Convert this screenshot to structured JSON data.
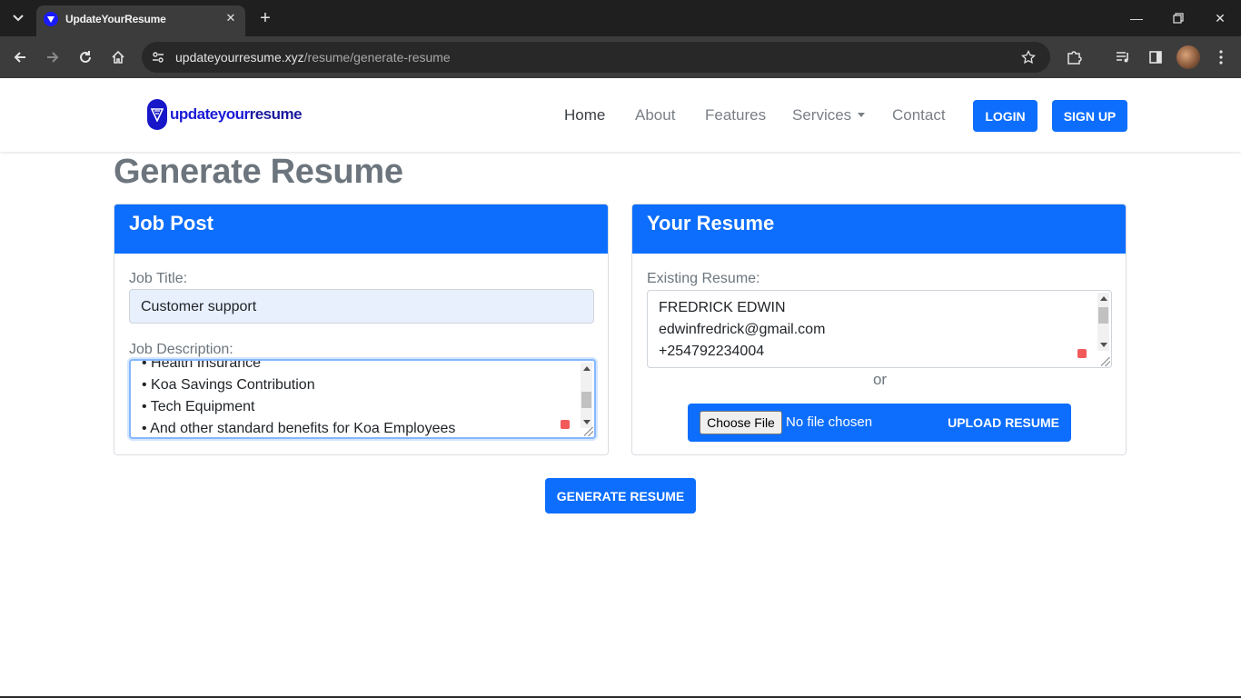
{
  "browser": {
    "tab_title": "UpdateYourResume",
    "url_domain": "updateyourresume.xyz",
    "url_path": "/resume/generate-resume"
  },
  "nav": {
    "brand_part1": "update",
    "brand_part2": "your",
    "brand_part3": "resume",
    "links": [
      "Home",
      "About",
      "Features",
      "Services",
      "Contact"
    ],
    "login_label": "LOGIN",
    "signup_label": "SIGN UP"
  },
  "page_title": "Generate Resume",
  "job_post": {
    "header": "Job Post",
    "title_label": "Job Title:",
    "title_value": "Customer support",
    "description_label": "Job Description:",
    "description_lines": [
      "• Health Insurance",
      "• Koa Savings Contribution",
      "• Tech Equipment",
      "• And other standard benefits for Koa Employees"
    ]
  },
  "your_resume": {
    "header": "Your Resume",
    "existing_label": "Existing Resume:",
    "resume_lines": [
      "FREDRICK EDWIN",
      "edwinfredrick@gmail.com",
      "+254792234004"
    ],
    "or_text": "or",
    "choose_file_label": "Choose File",
    "no_file_text": "No file chosen",
    "upload_label": "UPLOAD RESUME"
  },
  "generate_label": "GENERATE RESUME",
  "colors": {
    "primary": "#0d6efd",
    "title_gray": "#6c757d",
    "brand_blue": "#1a1ad6"
  }
}
